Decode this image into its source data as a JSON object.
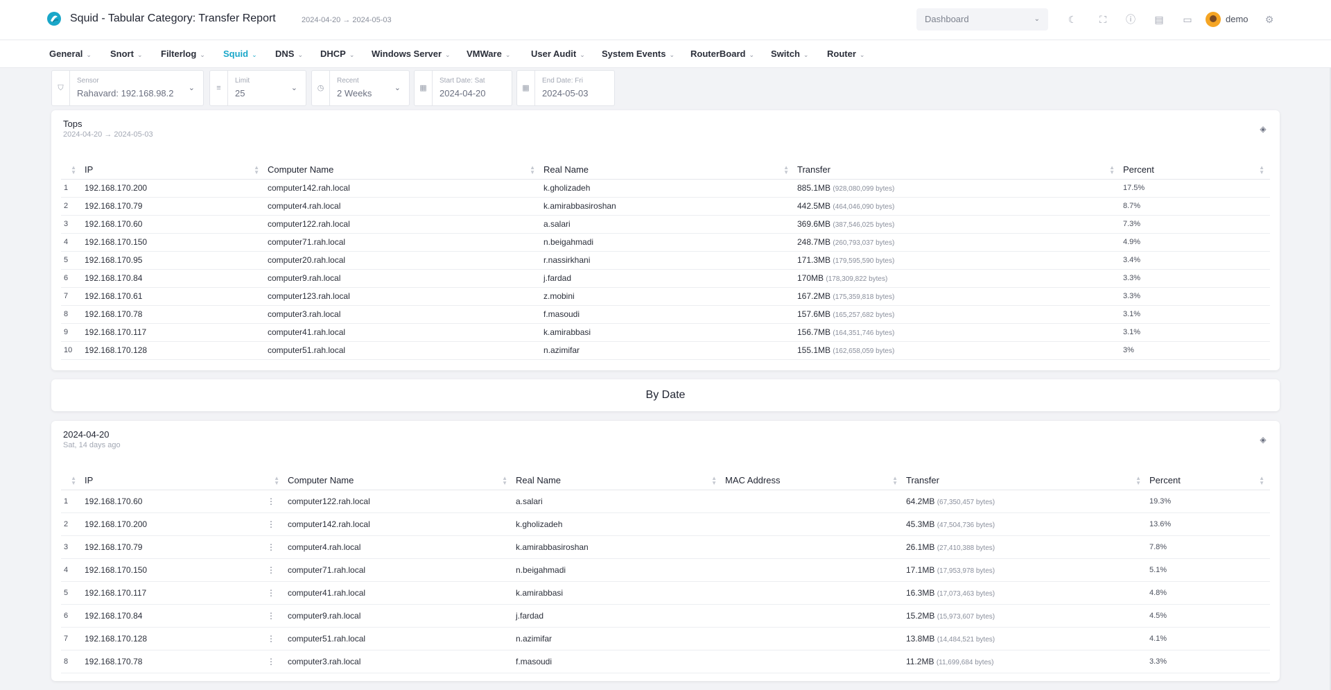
{
  "header": {
    "title": "Squid - Tabular Category: Transfer Report",
    "range": "2024-04-20 → 2024-05-03",
    "dashboard_select": "Dashboard",
    "user": "demo"
  },
  "nav": {
    "items": [
      {
        "label": "General"
      },
      {
        "label": "Snort"
      },
      {
        "label": "Filterlog"
      },
      {
        "label": "Squid"
      },
      {
        "label": "DNS"
      },
      {
        "label": "DHCP"
      },
      {
        "label": "Windows Server"
      },
      {
        "label": "VMWare"
      },
      {
        "label": "User Audit"
      },
      {
        "label": "System Events"
      },
      {
        "label": "RouterBoard"
      },
      {
        "label": "Switch"
      },
      {
        "label": "Router"
      }
    ],
    "active": "Squid"
  },
  "filters": {
    "sensor": {
      "label": "Sensor",
      "value": "Rahavard: 192.168.98.2"
    },
    "limit": {
      "label": "Limit",
      "value": "25"
    },
    "recent": {
      "label": "Recent",
      "value": "2 Weeks"
    },
    "start": {
      "label": "Start Date: Sat",
      "value": "2024-04-20"
    },
    "end": {
      "label": "End Date: Fri",
      "value": "2024-05-03"
    }
  },
  "tops": {
    "title": "Tops",
    "subtitle": "2024-04-20 → 2024-05-03",
    "columns": [
      "IP",
      "Computer Name",
      "Real Name",
      "Transfer",
      "Percent"
    ],
    "rows": [
      {
        "n": "1",
        "ip": "192.168.170.200",
        "computer": "computer142.rah.local",
        "real": "k.gholizadeh",
        "transfer": "885.1MB",
        "bytes": "(928,080,099 bytes)",
        "percent": "17.5%"
      },
      {
        "n": "2",
        "ip": "192.168.170.79",
        "computer": "computer4.rah.local",
        "real": "k.amirabbasiroshan",
        "transfer": "442.5MB",
        "bytes": "(464,046,090 bytes)",
        "percent": "8.7%"
      },
      {
        "n": "3",
        "ip": "192.168.170.60",
        "computer": "computer122.rah.local",
        "real": "a.salari",
        "transfer": "369.6MB",
        "bytes": "(387,546,025 bytes)",
        "percent": "7.3%"
      },
      {
        "n": "4",
        "ip": "192.168.170.150",
        "computer": "computer71.rah.local",
        "real": "n.beigahmadi",
        "transfer": "248.7MB",
        "bytes": "(260,793,037 bytes)",
        "percent": "4.9%"
      },
      {
        "n": "5",
        "ip": "192.168.170.95",
        "computer": "computer20.rah.local",
        "real": "r.nassirkhani",
        "transfer": "171.3MB",
        "bytes": "(179,595,590 bytes)",
        "percent": "3.4%"
      },
      {
        "n": "6",
        "ip": "192.168.170.84",
        "computer": "computer9.rah.local",
        "real": "j.fardad",
        "transfer": "170MB",
        "bytes": "(178,309,822 bytes)",
        "percent": "3.3%"
      },
      {
        "n": "7",
        "ip": "192.168.170.61",
        "computer": "computer123.rah.local",
        "real": "z.mobini",
        "transfer": "167.2MB",
        "bytes": "(175,359,818 bytes)",
        "percent": "3.3%"
      },
      {
        "n": "8",
        "ip": "192.168.170.78",
        "computer": "computer3.rah.local",
        "real": "f.masoudi",
        "transfer": "157.6MB",
        "bytes": "(165,257,682 bytes)",
        "percent": "3.1%"
      },
      {
        "n": "9",
        "ip": "192.168.170.117",
        "computer": "computer41.rah.local",
        "real": "k.amirabbasi",
        "transfer": "156.7MB",
        "bytes": "(164,351,746 bytes)",
        "percent": "3.1%"
      },
      {
        "n": "10",
        "ip": "192.168.170.128",
        "computer": "computer51.rah.local",
        "real": "n.azimifar",
        "transfer": "155.1MB",
        "bytes": "(162,658,059 bytes)",
        "percent": "3%"
      }
    ]
  },
  "bydate_title": "By Date",
  "day": {
    "title": "2024-04-20",
    "subtitle": "Sat, 14 days ago",
    "columns": [
      "IP",
      "Computer Name",
      "Real Name",
      "MAC Address",
      "Transfer",
      "Percent"
    ],
    "rows": [
      {
        "n": "1",
        "ip": "192.168.170.60",
        "computer": "computer122.rah.local",
        "real": "a.salari",
        "mac": "",
        "transfer": "64.2MB",
        "bytes": "(67,350,457 bytes)",
        "percent": "19.3%"
      },
      {
        "n": "2",
        "ip": "192.168.170.200",
        "computer": "computer142.rah.local",
        "real": "k.gholizadeh",
        "mac": "",
        "transfer": "45.3MB",
        "bytes": "(47,504,736 bytes)",
        "percent": "13.6%"
      },
      {
        "n": "3",
        "ip": "192.168.170.79",
        "computer": "computer4.rah.local",
        "real": "k.amirabbasiroshan",
        "mac": "",
        "transfer": "26.1MB",
        "bytes": "(27,410,388 bytes)",
        "percent": "7.8%"
      },
      {
        "n": "4",
        "ip": "192.168.170.150",
        "computer": "computer71.rah.local",
        "real": "n.beigahmadi",
        "mac": "",
        "transfer": "17.1MB",
        "bytes": "(17,953,978 bytes)",
        "percent": "5.1%"
      },
      {
        "n": "5",
        "ip": "192.168.170.117",
        "computer": "computer41.rah.local",
        "real": "k.amirabbasi",
        "mac": "",
        "transfer": "16.3MB",
        "bytes": "(17,073,463 bytes)",
        "percent": "4.8%"
      },
      {
        "n": "6",
        "ip": "192.168.170.84",
        "computer": "computer9.rah.local",
        "real": "j.fardad",
        "mac": "",
        "transfer": "15.2MB",
        "bytes": "(15,973,607 bytes)",
        "percent": "4.5%"
      },
      {
        "n": "7",
        "ip": "192.168.170.128",
        "computer": "computer51.rah.local",
        "real": "n.azimifar",
        "mac": "",
        "transfer": "13.8MB",
        "bytes": "(14,484,521 bytes)",
        "percent": "4.1%"
      },
      {
        "n": "8",
        "ip": "192.168.170.78",
        "computer": "computer3.rah.local",
        "real": "f.masoudi",
        "mac": "",
        "transfer": "11.2MB",
        "bytes": "(11,699,684 bytes)",
        "percent": "3.3%"
      }
    ]
  }
}
